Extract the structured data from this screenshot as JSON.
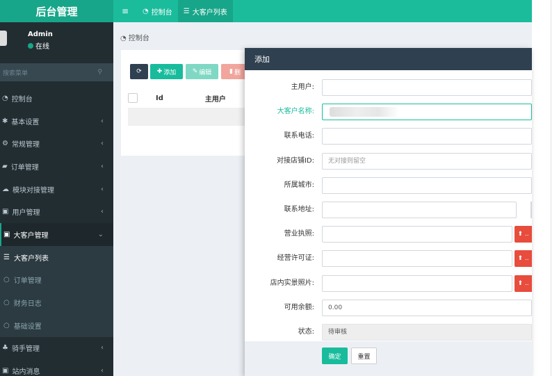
{
  "logo": "后台管理",
  "user": {
    "name": "Admin",
    "status": "在线"
  },
  "search": {
    "placeholder": "搜索菜单"
  },
  "menu": [
    {
      "icon": "dashboard-icon",
      "glyph": "◔",
      "label": "控制台"
    },
    {
      "icon": "gear-icon",
      "glyph": "✱",
      "label": "基本设置",
      "chevron": "‹"
    },
    {
      "icon": "cogs-icon",
      "glyph": "⚙",
      "label": "常规管理",
      "chevron": "‹"
    },
    {
      "icon": "book-icon",
      "glyph": "▰",
      "label": "订单管理",
      "chevron": "‹"
    },
    {
      "icon": "cloud-icon",
      "glyph": "☁",
      "label": "模块对接管理",
      "chevron": "‹"
    },
    {
      "icon": "user-card-icon",
      "glyph": "▣",
      "label": "用户管理",
      "chevron": "‹"
    },
    {
      "icon": "id-card-icon",
      "glyph": "▣",
      "label": "大客户管理",
      "chevron": "⌄"
    }
  ],
  "submenu": [
    {
      "glyph": "☰",
      "label": "大客户列表"
    },
    {
      "glyph": "○",
      "label": "订单管理"
    },
    {
      "glyph": "○",
      "label": "财务日志"
    },
    {
      "glyph": "○",
      "label": "基础设置"
    }
  ],
  "menu_after": [
    {
      "glyph": "♣",
      "label": "骑手管理",
      "chevron": "‹"
    },
    {
      "glyph": "▣",
      "label": "站内消息",
      "chevron": "‹"
    }
  ],
  "topbar": {
    "menu_glyph": "≡",
    "tabs": [
      {
        "glyph": "◔",
        "label": "控制台"
      },
      {
        "glyph": "☰",
        "label": "大客户列表"
      }
    ]
  },
  "breadcrumb": "控制台",
  "toolbar": {
    "refresh": "⟳",
    "add": "添加",
    "edit": "编辑",
    "delete": "删"
  },
  "table": {
    "columns": [
      "Id",
      "主用户"
    ]
  },
  "modal": {
    "title": "添加",
    "fields": {
      "main_user": {
        "label": "主用户:",
        "value": ""
      },
      "customer_name": {
        "label": "大客户名称:",
        "value": ""
      },
      "phone": {
        "label": "联系电话:",
        "value": ""
      },
      "store_id": {
        "label": "对接店铺ID:",
        "placeholder": "无对接则留空"
      },
      "city": {
        "label": "所属城市:",
        "value": ""
      },
      "address": {
        "label": "联系地址:",
        "value": ""
      },
      "license": {
        "label": "营业执照:",
        "value": ""
      },
      "permit": {
        "label": "经营许可证:",
        "value": ""
      },
      "photos": {
        "label": "店内实景照片:",
        "value": ""
      },
      "balance": {
        "label": "可用余额:",
        "value": "0.00"
      },
      "status": {
        "label": "状态:",
        "value": "待审核"
      }
    },
    "upload_glyph": "⬆ ..",
    "confirm": "确定",
    "reset": "重置"
  },
  "colors": {
    "accent": "#1abc9c",
    "sidebar": "#222d32",
    "danger": "#e74c3c",
    "modal_header": "#2f4050"
  }
}
